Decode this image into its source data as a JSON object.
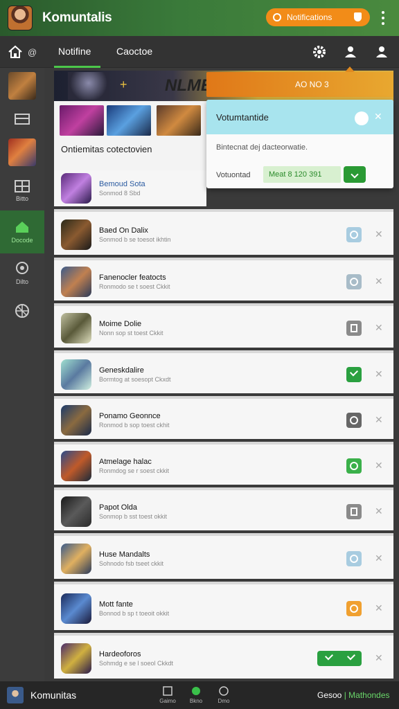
{
  "app": {
    "title": "Komuntalis",
    "notification_pill": "Notifications"
  },
  "navbar": {
    "home_sub": "@",
    "tabs": [
      {
        "label": "Notifine"
      },
      {
        "label": "Caoctoe"
      }
    ]
  },
  "rail": [
    {
      "label": ""
    },
    {
      "label": ""
    },
    {
      "label": ""
    },
    {
      "label": "Bitto"
    },
    {
      "label": "Docode"
    },
    {
      "label": "Dilto"
    },
    {
      "label": ""
    }
  ],
  "banner": {
    "text": "NLME",
    "arrow": "+"
  },
  "featured": {
    "label": "Ontiemitas  cotectovien"
  },
  "popup": {
    "header": "AO NO 3",
    "title": "Votumtantide",
    "description": "Bintecnat dej dacteorwatie.",
    "field_label": "Votuontad",
    "field_value": "Meat 8 120 391"
  },
  "rows": [
    {
      "title": "Bemoud Sota",
      "subtitle": "Sonmod 8 Sbd",
      "check": "none",
      "first": true
    },
    {
      "title": "Baed On Dalix",
      "subtitle": "Sonmod b se toesot ikhtin",
      "check": "heart",
      "color": "#a8cce0"
    },
    {
      "title": "Fanenocler featocts",
      "subtitle": "Ronmodo se t soest Ckkit",
      "check": "ring",
      "color": "#a8bcc8"
    },
    {
      "title": "Moime Dolie",
      "subtitle": "Nonn sop st toest Ckkit",
      "check": "square",
      "color": "#8a8a8a"
    },
    {
      "title": "Geneskdalire",
      "subtitle": "Bormtog at soesopt Ckxdt",
      "check": "check",
      "color": "#2aa040"
    },
    {
      "title": "Ponamo Geonnce",
      "subtitle": "Ronmod b sop toest ckhit",
      "check": "ring",
      "color": "#666666"
    },
    {
      "title": "Atmelage halac",
      "subtitle": "Ronmdog se r soest ckkit",
      "check": "ring",
      "color": "#3ab04a"
    },
    {
      "title": "Papot Olda",
      "subtitle": "Sonmop b sst toest okkit",
      "check": "square",
      "color": "#8a8a8a"
    },
    {
      "title": "Huse Mandalts",
      "subtitle": "Sohnodo fsb tseet ckkit",
      "check": "heart",
      "color": "#a8cce0"
    },
    {
      "title": "Mott fante",
      "subtitle": "Bonnod b sp t toeoit okkit",
      "check": "ring",
      "color": "#f0a030"
    },
    {
      "title": "Hardeoforos",
      "subtitle": "Sohmdg e se l soeol Ckkdt",
      "check": "double",
      "color": "#2aa040"
    }
  ],
  "bottombar": {
    "title": "Komunitas",
    "items": [
      {
        "label": "Gaimo"
      },
      {
        "label": "Bkno"
      },
      {
        "label": "Dmo"
      }
    ],
    "right_a": "Gesoo",
    "right_b": "| Mathondes"
  }
}
